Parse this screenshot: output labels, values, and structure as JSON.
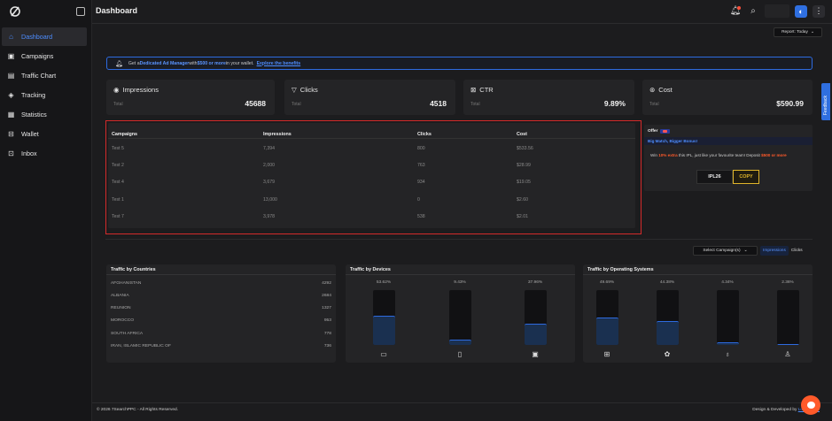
{
  "sidebar": {
    "logo_icon": "logo-mark-icon",
    "items": [
      {
        "label": "Dashboard",
        "icon": "home-icon",
        "active": true
      },
      {
        "label": "Campaigns",
        "icon": "campaigns-icon",
        "active": false
      },
      {
        "label": "Traffic Chart",
        "icon": "chart-icon",
        "active": false
      },
      {
        "label": "Tracking",
        "icon": "tracking-icon",
        "active": false
      },
      {
        "label": "Statistics",
        "icon": "statistics-icon",
        "active": false
      },
      {
        "label": "Wallet",
        "icon": "wallet-icon",
        "active": false
      },
      {
        "label": "Inbox",
        "icon": "inbox-icon",
        "active": false
      }
    ]
  },
  "header": {
    "title": "Dashboard",
    "report_label": "Report: Today"
  },
  "banner": {
    "prefix": "Get a ",
    "strong": "Dedicated Ad Manager",
    "middle": " with ",
    "amount": "$500 or more",
    "suffix": " in your wallet.",
    "link": "Explore the benefits"
  },
  "stats": [
    {
      "title": "Impressions",
      "icon": "eye-icon",
      "label": "Total",
      "value": "45688"
    },
    {
      "title": "Clicks",
      "icon": "cursor-icon",
      "label": "Total",
      "value": "4518"
    },
    {
      "title": "CTR",
      "icon": "ctr-icon",
      "label": "Total",
      "value": "9.89%"
    },
    {
      "title": "Cost",
      "icon": "cost-icon",
      "label": "Total",
      "value": "$590.99"
    }
  ],
  "campaigns_table": {
    "headers": [
      "Campaigns",
      "Impressions",
      "Clicks",
      "Cost"
    ],
    "rows": [
      [
        "Test 5",
        "7,394",
        "800",
        "$533.56"
      ],
      [
        "Test 2",
        "2,000",
        "763",
        "$28.99"
      ],
      [
        "Test 4",
        "3,679",
        "934",
        "$19.05"
      ],
      [
        "Test 1",
        "13,000",
        "0",
        "$2.60"
      ],
      [
        "Test 7",
        "3,978",
        "538",
        "$2.01"
      ]
    ]
  },
  "offer": {
    "title": "Offer",
    "headline": "Big Match, Bigger Bonus!",
    "text_prefix": "Win ",
    "text_highlight": "10% extra",
    "text_middle": " this IPL, just like your favourite team! Deposit ",
    "text_amount": "$500 or more",
    "code": "IPL26",
    "copy_label": "COPY"
  },
  "filters": {
    "select_label": "Select Campaign(s)",
    "toggle_on": "Impressions",
    "toggle_off": "Clicks"
  },
  "countries": {
    "title": "Traffic by Countries",
    "rows": [
      {
        "name": "AFGHANISTAN",
        "value": "4292"
      },
      {
        "name": "ALBANIA",
        "value": "2684"
      },
      {
        "name": "REUNION",
        "value": "1327"
      },
      {
        "name": "MOROCCO",
        "value": "953"
      },
      {
        "name": "SOUTH AFRICA",
        "value": "778"
      },
      {
        "name": "IRAN, ISLAMIC REPUBLIC OF",
        "value": "736"
      }
    ]
  },
  "devices": {
    "title": "Traffic by Devices",
    "items": [
      {
        "label": "53.62%",
        "value": 53.62,
        "icon": "desktop-icon"
      },
      {
        "label": "9.43%",
        "value": 9.43,
        "icon": "tablet-icon"
      },
      {
        "label": "37.96%",
        "value": 37.96,
        "icon": "mobile-icon"
      }
    ]
  },
  "os": {
    "title": "Traffic by Operating Systems",
    "items": [
      {
        "label": "49.69%",
        "value": 49.69,
        "icon": "windows-icon"
      },
      {
        "label": "44.38%",
        "value": 44.38,
        "icon": "android-icon"
      },
      {
        "label": "4.34%",
        "value": 4.34,
        "icon": "apple-icon"
      },
      {
        "label": "2.36%",
        "value": 2.36,
        "icon": "linux-icon"
      }
    ]
  },
  "footer": {
    "copyright": "© 2026 7SearchPPC",
    "rights": " - All Rights Reserved.",
    "credit": "Design & Developed by ",
    "credit_link": "LogelRes..."
  },
  "feedback_label": "Feedback",
  "colors": {
    "accent": "#2f6fe0",
    "highlight": "#d42a2a",
    "orange": "#ff5a2a"
  }
}
